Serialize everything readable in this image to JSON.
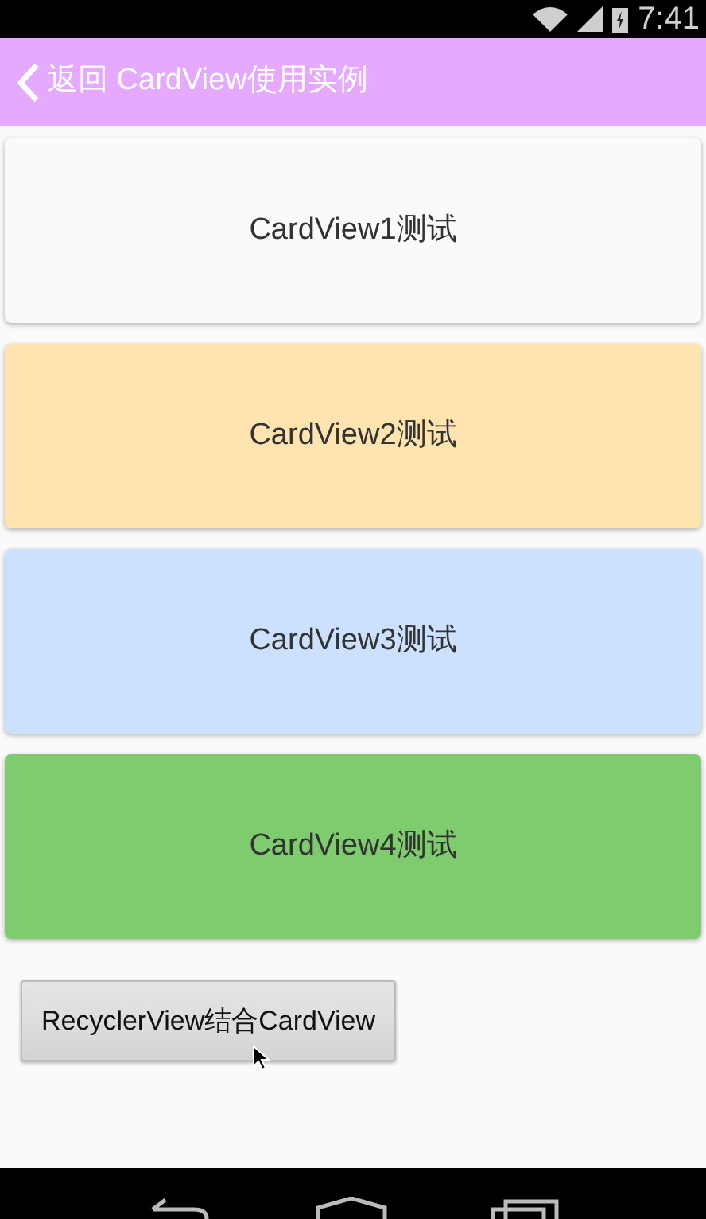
{
  "status_bar": {
    "time": "7:41"
  },
  "app_bar": {
    "title": "返回 CardView使用实例"
  },
  "cards": [
    {
      "label": "CardView1测试",
      "color": "#fafafa"
    },
    {
      "label": "CardView2测试",
      "color": "#ffe4b0"
    },
    {
      "label": "CardView3测试",
      "color": "#cce0ff"
    },
    {
      "label": "CardView4测试",
      "color": "#7fcc6f"
    }
  ],
  "button": {
    "label": "RecyclerView结合CardView"
  }
}
